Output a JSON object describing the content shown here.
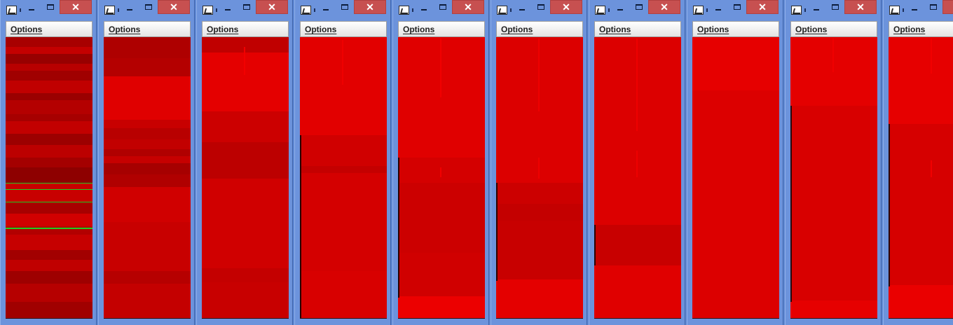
{
  "windows": [
    {
      "id": "w1",
      "close_symbol": "✕",
      "menu": "Options"
    },
    {
      "id": "w2",
      "close_symbol": "✕",
      "menu": "Options"
    },
    {
      "id": "w3",
      "close_symbol": "✕",
      "menu": "Options"
    },
    {
      "id": "w4",
      "close_symbol": "✕",
      "menu": "Options"
    },
    {
      "id": "w5",
      "close_symbol": "✕",
      "menu": "Options"
    },
    {
      "id": "w6",
      "close_symbol": "✕",
      "menu": "Options"
    },
    {
      "id": "w7",
      "close_symbol": "✕",
      "menu": "Options"
    },
    {
      "id": "w8",
      "close_symbol": "✕",
      "menu": "Options"
    },
    {
      "id": "w9",
      "close_symbol": "✕",
      "menu": "Options"
    },
    {
      "id": "w10",
      "close_symbol": "✕",
      "menu": "Options"
    }
  ],
  "colors": {
    "red_bright": "#e00000",
    "red_mid": "#cc0000",
    "red_dark": "#a00000",
    "green_line": "#22cc22",
    "title_blue": "#6c93dc",
    "close_red": "#c75050"
  }
}
